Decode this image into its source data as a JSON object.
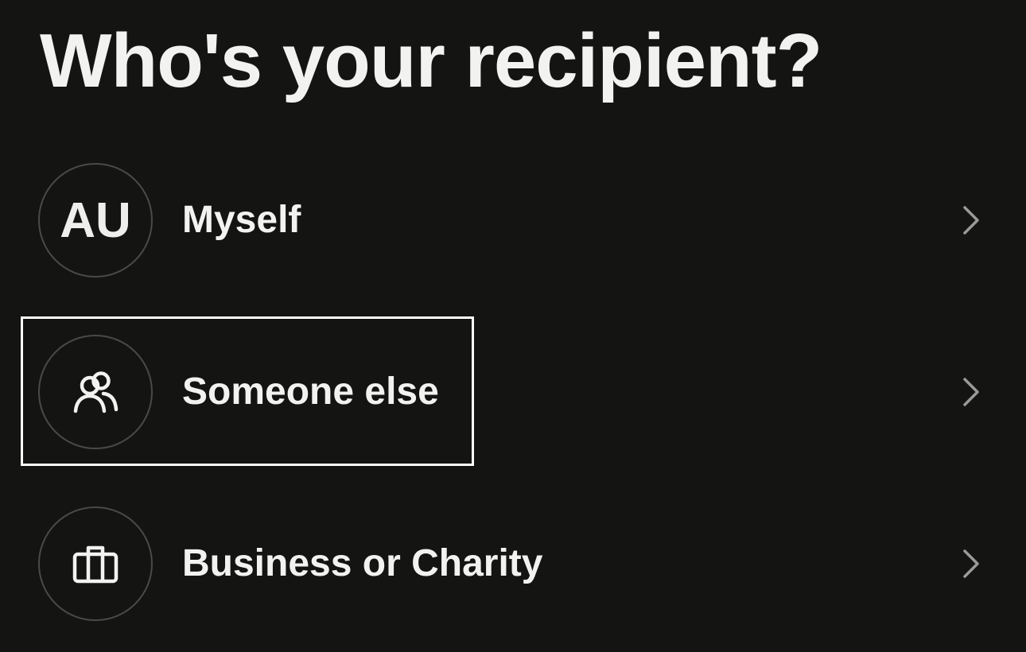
{
  "page": {
    "title": "Who's your recipient?"
  },
  "options": [
    {
      "label": "Myself",
      "avatar_text": "AU",
      "icon": "chevron-right-icon"
    },
    {
      "label": "Someone else",
      "avatar_icon": "people-icon",
      "icon": "chevron-right-icon",
      "highlighted": true
    },
    {
      "label": "Business or Charity",
      "avatar_icon": "briefcase-icon",
      "icon": "chevron-right-icon"
    }
  ],
  "colors": {
    "background": "#141513",
    "text": "#f2f3f0",
    "circle_border": "#4a4b48",
    "chevron": "#9a9b98",
    "highlight_border": "#ffffff"
  }
}
